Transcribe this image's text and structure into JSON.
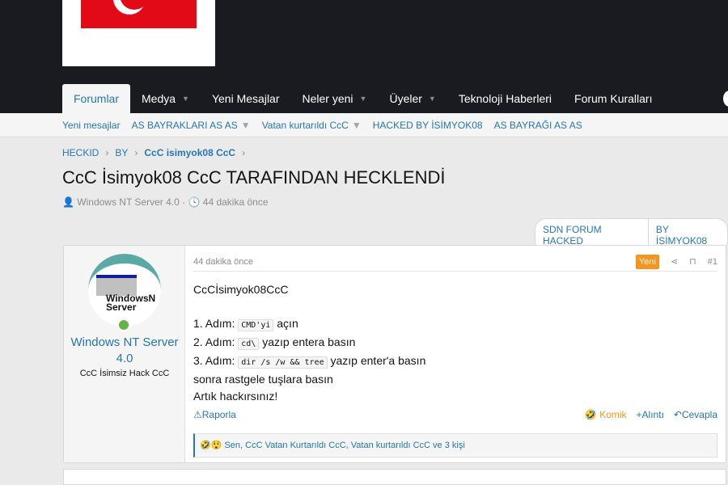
{
  "nav": {
    "tabs": [
      "Forumlar",
      "Medya",
      "Yeni Mesajlar",
      "Neler yeni",
      "Üyeler",
      "Teknoloji Haberleri",
      "Forum Kuralları"
    ]
  },
  "subnav": [
    "Yeni mesajlar",
    "AS BAYRAKLARI AS AS",
    "Vatan kurtarıldı CcC",
    "HACKED BY İSİMYOK08",
    "AS BAYRAĞI AS AS"
  ],
  "breadcrumb": [
    "HECKID",
    "BY",
    "CcC isimyok08 CcC"
  ],
  "thread": {
    "title": "CcC İsimyok08 CcC TARAFINDAN HECKLENDİ",
    "author": "Windows NT Server 4.0",
    "time": "44 dakika önce",
    "tags": [
      "SDN FORUM HACKED",
      "BY İSİMYOK08"
    ]
  },
  "post": {
    "user": "Windows NT Server 4.0",
    "user_title": "CcC İsimsiz Hack CcC",
    "time": "44 dakika önce",
    "badge": "Yeni",
    "number": "#1",
    "line0": "CcCİsimyok08CcC",
    "l1a": "1. Adım: ",
    "l1c": "CMD'yi",
    "l1b": " açın",
    "l2a": "2. Adım: ",
    "l2c": "cd\\",
    "l2b": " yazıp entera basın",
    "l3a": "3. Adım: ",
    "l3c": "dir /s /w && tree",
    "l3b": " yazıp enter'a basın",
    "line4": "sonra rastgele tuşlara basın",
    "line5": "Artık hackırsınız!",
    "report": "Raporla",
    "komik": "Komik",
    "quote": "+Alıntı",
    "reply": "Cevapla",
    "reactions": "Sen, CcC Vatan Kurtarıldı CcC, Vatan kurtarıldı CcC ve 3 kişi"
  }
}
